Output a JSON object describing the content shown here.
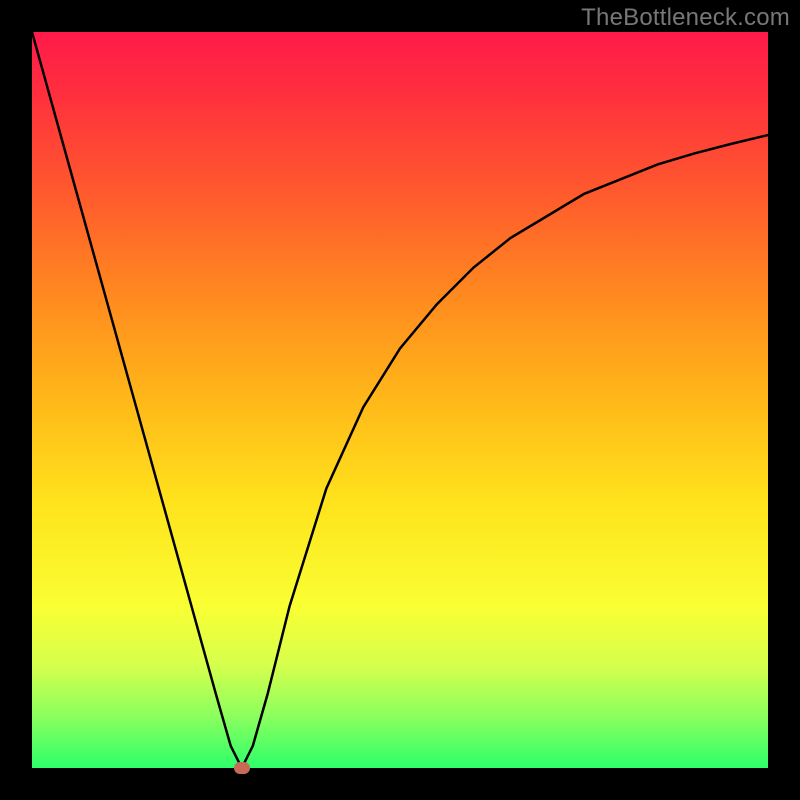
{
  "watermark": "TheBottleneck.com",
  "chart_data": {
    "type": "line",
    "title": "",
    "xlabel": "",
    "ylabel": "",
    "xlim": [
      0,
      100
    ],
    "ylim": [
      0,
      100
    ],
    "grid": false,
    "series": [
      {
        "name": "curve",
        "x": [
          0,
          5,
          10,
          15,
          20,
          25,
          27,
          28.5,
          30,
          32,
          35,
          40,
          45,
          50,
          55,
          60,
          65,
          70,
          75,
          80,
          85,
          90,
          95,
          100
        ],
        "y": [
          100,
          82,
          64,
          46,
          28,
          10,
          3,
          0,
          3,
          10,
          22,
          38,
          49,
          57,
          63,
          68,
          72,
          75,
          78,
          80,
          82,
          83.5,
          84.8,
          86
        ]
      }
    ],
    "marker": {
      "x": 28.5,
      "y": 0,
      "color": "#c76a56"
    },
    "background_gradient": {
      "top": "#ff1a4a",
      "bottom": "#2dff6a"
    }
  }
}
